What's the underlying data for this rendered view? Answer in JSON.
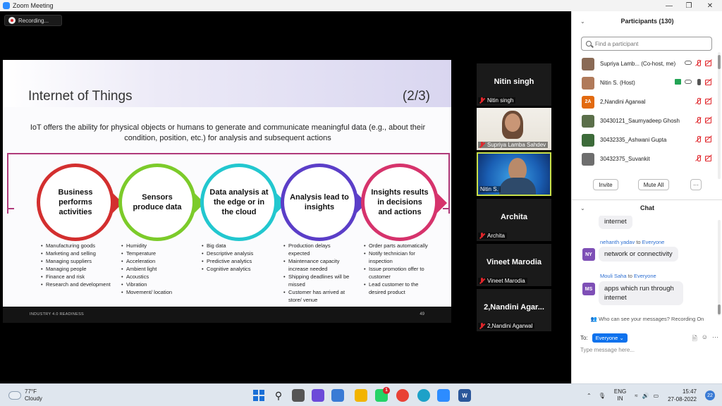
{
  "window": {
    "title": "Zoom Meeting"
  },
  "recording": {
    "label": "Recording..."
  },
  "slide": {
    "title": "Internet of Things",
    "page_indicator": "(2/3)",
    "intro": "IoT offers the ability for physical objects or humans to generate and communicate meaningful data (e.g., about their condition, position, etc.) for analysis and subsequent actions",
    "footer_left": "INDUSTRY 4.0 READINESS",
    "footer_right": "49",
    "steps": [
      {
        "label": "Business performs activities",
        "color": "#d32f2f",
        "bullets": [
          "Manufacturing goods",
          "Marketing and selling",
          "Managing suppliers",
          "Managing people",
          "Finance and risk",
          "Research and development"
        ]
      },
      {
        "label": "Sensors produce data",
        "color": "#7ccb2a",
        "bullets": [
          "Humidity",
          "Temperature",
          "Acceleration",
          "Ambient light",
          "Acoustics",
          "Vibration",
          "Movement/ location"
        ]
      },
      {
        "label": "Data analysis at the edge or in the cloud",
        "color": "#22c7cf",
        "bullets": [
          "Big data",
          "Descriptive analysis",
          "Predictive analytics",
          "Cognitive analytics"
        ]
      },
      {
        "label": "Analysis lead to insights",
        "color": "#5b3ec8",
        "bullets": [
          "Production delays expected",
          "Maintenance capacity increase needed",
          "Shipping deadlines will be missed",
          "Customer has arrived at store/ venue"
        ]
      },
      {
        "label": "Insights results in decisions and actions",
        "color": "#d6336c",
        "bullets": [
          "Order parts automatically",
          "Notify technician for inspection",
          "Issue promotion offer to customer",
          "Lead customer to the desired product"
        ]
      }
    ]
  },
  "tiles": [
    {
      "name": "Nitin singh",
      "label": "Nitin singh",
      "kind": "name"
    },
    {
      "name": "",
      "label": "Supriya Lamba  Sahdev",
      "kind": "video1"
    },
    {
      "name": "",
      "label": "Nitin S.",
      "kind": "video2"
    },
    {
      "name": "Archita",
      "label": "Archita",
      "kind": "name"
    },
    {
      "name": "Vineet Marodia",
      "label": "Vineet Marodia",
      "kind": "name"
    },
    {
      "name": "2,Nandini  Agar...",
      "label": "2,Nandini Agarwal",
      "kind": "name"
    }
  ],
  "participants": {
    "header": "Participants (130)",
    "search_placeholder": "Find a participant",
    "list": [
      {
        "name": "Supriya Lamb...  (Co-host, me)",
        "initials": "",
        "color": "#8a6a55"
      },
      {
        "name": "Nitin S. (Host)",
        "initials": "",
        "color": "#b07a5a"
      },
      {
        "name": "2,Nandini Agarwal",
        "initials": "2A",
        "color": "#e26a10"
      },
      {
        "name": "30430121_Saumyadeep Ghosh",
        "initials": "",
        "color": "#5b6f4a"
      },
      {
        "name": "30432335_Ashwani Gupta",
        "initials": "",
        "color": "#3d6b3a"
      },
      {
        "name": "30432375_Suvankit",
        "initials": "",
        "color": "#6e6e6e"
      }
    ],
    "invite_label": "Invite",
    "mute_all_label": "Mute All",
    "more_label": "···"
  },
  "chat": {
    "header": "Chat",
    "partial_message": "internet",
    "messages": [
      {
        "sender": "nehanth yadav",
        "to_word": "to",
        "recipient": "Everyone",
        "initials": "NY",
        "text": "network or connectivity"
      },
      {
        "sender": "Mouli Saha",
        "to_word": "to",
        "recipient": "Everyone",
        "initials": "MS",
        "text": "apps which run through internet"
      }
    ],
    "notice": "Who can see your messages? Recording On",
    "to_label": "To:",
    "to_value": "Everyone ⌄",
    "input_placeholder": "Type message here..."
  },
  "taskbar": {
    "temperature": "77°F",
    "condition": "Cloudy",
    "lang1": "ENG",
    "lang2": "IN",
    "time": "15:47",
    "date": "27-08-2022",
    "notifications": "22",
    "whatsapp_badge": "1"
  },
  "colors": {
    "zoom_blue": "#0e72ed",
    "mute_red": "#e0262b"
  }
}
